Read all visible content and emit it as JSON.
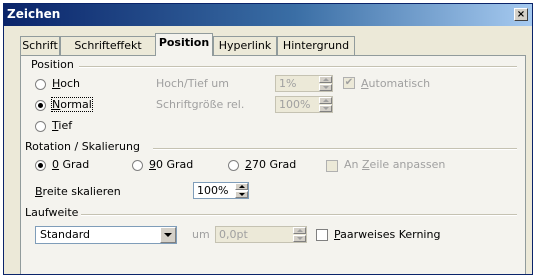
{
  "window": {
    "title": "Zeichen",
    "close": "×"
  },
  "tabs": [
    "Schrift",
    "Schrifteffekt",
    "Position",
    "Hyperlink",
    "Hintergrund"
  ],
  "position": {
    "heading": "Position",
    "options": [
      {
        "mn": "H",
        "rest": "och",
        "checked": false
      },
      {
        "mn": "N",
        "rest": "ormal",
        "checked": true
      },
      {
        "mn": "T",
        "rest": "ief",
        "checked": false
      }
    ],
    "hochtief_label": "Hoch/Tief um",
    "hochtief_value": "1%",
    "auto_label_mn": "A",
    "auto_label_rest": "utomatisch",
    "auto_checked": true,
    "size_label": "Schriftgröße rel.",
    "size_value": "100%"
  },
  "rotation": {
    "heading": "Rotation / Skalierung",
    "options": [
      {
        "mn": "0",
        "rest": " Grad",
        "checked": true
      },
      {
        "mn": "9",
        "rest": "0 Grad",
        "checked": false
      },
      {
        "mn": "2",
        "rest": "70 Grad",
        "checked": false
      }
    ],
    "fit_pre": "An ",
    "fit_mn": "Z",
    "fit_rest": "eile anpassen",
    "scale_mn": "B",
    "scale_rest": "reite skalieren",
    "scale_value": "100%"
  },
  "spacing": {
    "heading": "Laufweite",
    "select_value": "Standard",
    "by_label": "um",
    "by_value": "0,0pt",
    "kerning_mn": "P",
    "kerning_rest": "aarweises Kerning",
    "kerning_checked": false
  }
}
